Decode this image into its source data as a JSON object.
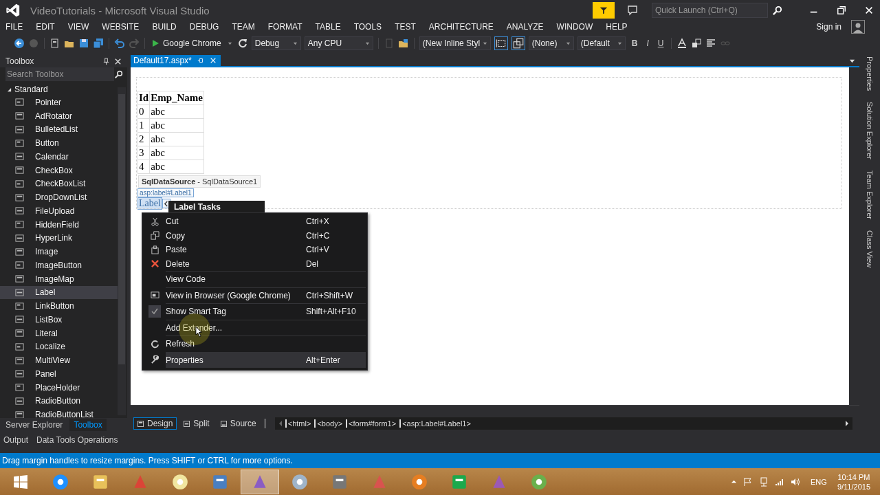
{
  "window": {
    "title": "VideoTutorials - Microsoft Visual Studio",
    "quick_launch": {
      "placeholder": "Quick Launch (Ctrl+Q)"
    }
  },
  "menu": [
    "FILE",
    "EDIT",
    "VIEW",
    "WEBSITE",
    "BUILD",
    "DEBUG",
    "TEAM",
    "FORMAT",
    "TABLE",
    "TOOLS",
    "TEST",
    "ARCHITECTURE",
    "ANALYZE",
    "WINDOW",
    "HELP"
  ],
  "sign_in": "Sign in",
  "toolbar": {
    "target": "Google Chrome",
    "configuration": "Debug",
    "platform": "Any CPU",
    "style": "(New Inline Styl",
    "target_rule": "(None)",
    "font": "(Default",
    "format_buttons": [
      {
        "label": "B",
        "kind": "bold"
      },
      {
        "label": "I",
        "kind": "italic"
      },
      {
        "label": "U",
        "kind": "underline"
      }
    ]
  },
  "toolbox": {
    "title": "Toolbox",
    "search": {
      "placeholder": "Search Toolbox"
    },
    "group": {
      "label": "Standard",
      "expanded": true,
      "items": [
        {
          "label": "Pointer",
          "selected": false
        },
        {
          "label": "AdRotator",
          "selected": false
        },
        {
          "label": "BulletedList",
          "selected": false
        },
        {
          "label": "Button",
          "selected": false
        },
        {
          "label": "Calendar",
          "selected": false
        },
        {
          "label": "CheckBox",
          "selected": false
        },
        {
          "label": "CheckBoxList",
          "selected": false
        },
        {
          "label": "DropDownList",
          "selected": false
        },
        {
          "label": "FileUpload",
          "selected": false
        },
        {
          "label": "HiddenField",
          "selected": false
        },
        {
          "label": "HyperLink",
          "selected": false
        },
        {
          "label": "Image",
          "selected": false
        },
        {
          "label": "ImageButton",
          "selected": false
        },
        {
          "label": "ImageMap",
          "selected": false
        },
        {
          "label": "Label",
          "selected": true
        },
        {
          "label": "LinkButton",
          "selected": false
        },
        {
          "label": "ListBox",
          "selected": false
        },
        {
          "label": "Literal",
          "selected": false
        },
        {
          "label": "Localize",
          "selected": false
        },
        {
          "label": "MultiView",
          "selected": false
        },
        {
          "label": "Panel",
          "selected": false
        },
        {
          "label": "PlaceHolder",
          "selected": false
        },
        {
          "label": "RadioButton",
          "selected": false
        },
        {
          "label": "RadioButtonList",
          "selected": false
        }
      ]
    },
    "bottom_tabs": [
      {
        "label": "Server Explorer",
        "selected": false
      },
      {
        "label": "Toolbox",
        "selected": true
      }
    ]
  },
  "document": {
    "tab": {
      "label": "Default17.aspx*",
      "selected": true
    },
    "table": {
      "columns": [
        "Id",
        "Emp_Name"
      ],
      "rows": [
        [
          "0",
          "abc"
        ],
        [
          "1",
          "abc"
        ],
        [
          "2",
          "abc"
        ],
        [
          "3",
          "abc"
        ],
        [
          "4",
          "abc"
        ]
      ]
    },
    "data_source": "**SqlDataSource** - SqlDataSource1",
    "element_tag": "asp:label#Label1",
    "label_control": "Label",
    "smart_tag_title": "Label Tasks",
    "context_menu": [
      {
        "label": "Cut",
        "shortcut": "Ctrl+X",
        "checked": false,
        "selected": false
      },
      {
        "label": "Copy",
        "shortcut": "Ctrl+C",
        "checked": false,
        "selected": false
      },
      {
        "label": "Paste",
        "shortcut": "Ctrl+V",
        "checked": false,
        "selected": false
      },
      {
        "label": "Delete",
        "shortcut": "Del",
        "checked": false,
        "selected": false
      },
      {
        "label": "View Code",
        "checked": false,
        "selected": false
      },
      {
        "label": "View in Browser (Google Chrome)",
        "shortcut": "Ctrl+Shift+W",
        "checked": false,
        "selected": false
      },
      {
        "label": "Show Smart Tag",
        "shortcut": "Shift+Alt+F10",
        "checked": true,
        "selected": false
      },
      {
        "label": "Add Extender...",
        "checked": false,
        "selected": false
      },
      {
        "label": "Refresh",
        "checked": false,
        "selected": false
      },
      {
        "label": "Properties",
        "shortcut": "Alt+Enter",
        "checked": false,
        "selected": true
      }
    ],
    "views": [
      {
        "label": "Design",
        "selected": true
      },
      {
        "label": "Split",
        "selected": false
      },
      {
        "label": "Source",
        "selected": false
      }
    ],
    "breadcrumbs": [
      "<html>",
      "<body>",
      "<form#form1>",
      "<asp:Label#Label1>"
    ]
  },
  "side_tabs": [
    "Properties",
    "Solution Explorer",
    "Team Explorer",
    "Class View"
  ],
  "output_tabs": [
    "Output",
    "Data Tools Operations"
  ],
  "status_bar": "Drag margin handles to resize margins. Press SHIFT or CTRL for more options.",
  "taskbar": {
    "apps": [
      {
        "selected": false
      },
      {
        "selected": false
      },
      {
        "selected": false
      },
      {
        "selected": false
      },
      {
        "selected": false
      },
      {
        "selected": true
      },
      {
        "selected": false
      },
      {
        "selected": false
      },
      {
        "selected": false
      },
      {
        "selected": false
      },
      {
        "selected": false
      },
      {
        "selected": false
      },
      {
        "selected": false
      }
    ],
    "language": "ENG",
    "time": "10:14 PM",
    "date": "9/11/2015"
  }
}
